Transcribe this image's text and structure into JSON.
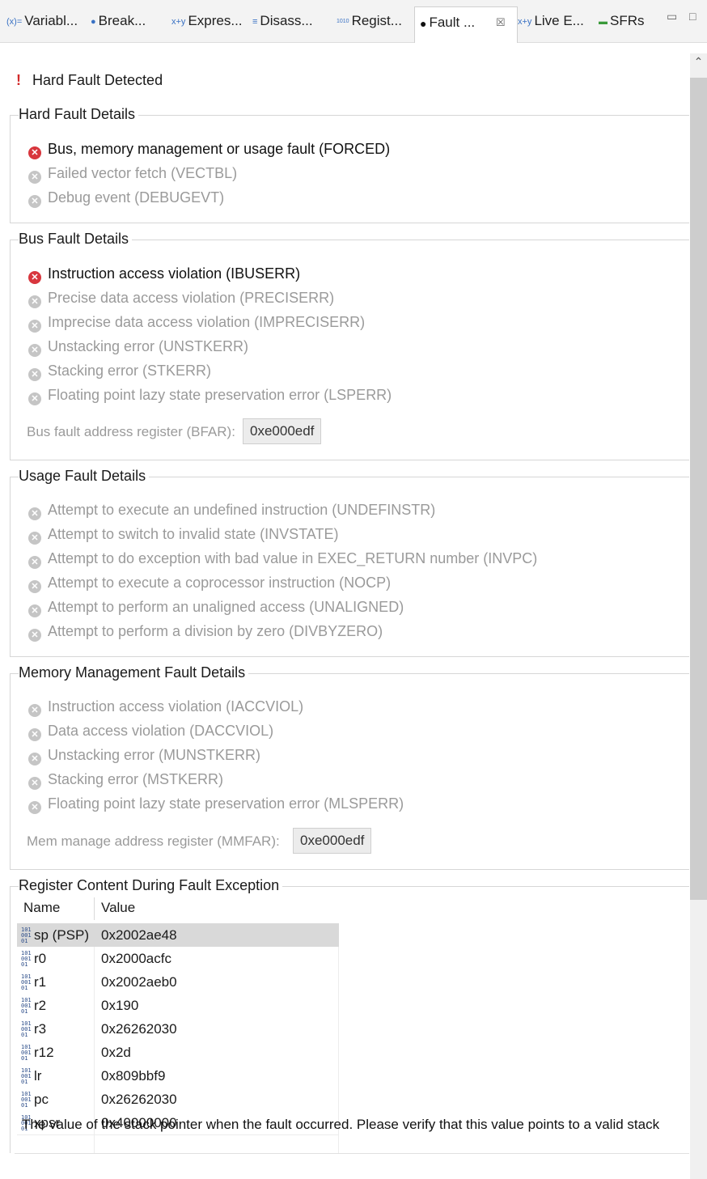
{
  "tabs": [
    {
      "label": "Variabl...",
      "icon": "variables-icon",
      "icon_text": "(x)="
    },
    {
      "label": "Break...",
      "icon": "breakpoints-icon",
      "icon_text": "●"
    },
    {
      "label": "Expres...",
      "icon": "expressions-icon",
      "icon_text": "x+y"
    },
    {
      "label": "Disass...",
      "icon": "disassembly-icon",
      "icon_text": "≡"
    },
    {
      "label": "Regist...",
      "icon": "registers-icon",
      "icon_text": "1010"
    },
    {
      "label": "Fault ...",
      "icon": "fault-analyzer-icon",
      "icon_text": "●",
      "active": true
    },
    {
      "label": "Live E...",
      "icon": "live-expressions-icon",
      "icon_text": "x+y"
    },
    {
      "label": "SFRs",
      "icon": "sfrs-icon",
      "icon_text": "▬"
    }
  ],
  "close_glyph": "☒",
  "header": {
    "alert": "Hard Fault Detected"
  },
  "hard_fault": {
    "title": "Hard Fault Details",
    "items": [
      {
        "text": "Bus, memory management or usage fault (FORCED)",
        "active": true
      },
      {
        "text": "Failed vector fetch (VECTBL)",
        "active": false
      },
      {
        "text": "Debug event (DEBUGEVT)",
        "active": false
      }
    ]
  },
  "bus_fault": {
    "title": "Bus Fault Details",
    "items": [
      {
        "text": "Instruction access violation (IBUSERR)",
        "active": true
      },
      {
        "text": "Precise data access violation (PRECISERR)",
        "active": false
      },
      {
        "text": "Imprecise data access violation (IMPRECISERR)",
        "active": false
      },
      {
        "text": "Unstacking error (UNSTKERR)",
        "active": false
      },
      {
        "text": "Stacking error (STKERR)",
        "active": false
      },
      {
        "text": "Floating point lazy state preservation error (LSPERR)",
        "active": false
      }
    ],
    "address_label": "Bus fault address register (BFAR):",
    "address_value": "0xe000edf"
  },
  "usage_fault": {
    "title": "Usage Fault Details",
    "items": [
      {
        "text": "Attempt to execute an undefined instruction (UNDEFINSTR)",
        "active": false
      },
      {
        "text": "Attempt to switch to invalid state (INVSTATE)",
        "active": false
      },
      {
        "text": "Attempt to do exception with bad value in EXEC_RETURN number (INVPC)",
        "active": false
      },
      {
        "text": "Attempt to execute a coprocessor instruction (NOCP)",
        "active": false
      },
      {
        "text": "Attempt to perform an unaligned access (UNALIGNED)",
        "active": false
      },
      {
        "text": "Attempt to perform a division by zero (DIVBYZERO)",
        "active": false
      }
    ]
  },
  "mem_fault": {
    "title": "Memory Management Fault Details",
    "items": [
      {
        "text": "Instruction access violation (IACCVIOL)",
        "active": false
      },
      {
        "text": "Data access violation (DACCVIOL)",
        "active": false
      },
      {
        "text": "Unstacking error (MUNSTKERR)",
        "active": false
      },
      {
        "text": "Stacking error (MSTKERR)",
        "active": false
      },
      {
        "text": "Floating point lazy state preservation error (MLSPERR)",
        "active": false
      }
    ],
    "address_label": "Mem manage address register (MMFAR):",
    "address_value": "0xe000edf"
  },
  "registers": {
    "title": "Register Content During Fault Exception",
    "columns": [
      "Name",
      "Value"
    ],
    "rows": [
      {
        "name": "sp (PSP)",
        "value": "0x2002ae48",
        "selected": true
      },
      {
        "name": "r0",
        "value": "0x2000acfc"
      },
      {
        "name": "r1",
        "value": "0x2002aeb0"
      },
      {
        "name": "r2",
        "value": "0x190"
      },
      {
        "name": "r3",
        "value": "0x26262030"
      },
      {
        "name": "r12",
        "value": "0x2d"
      },
      {
        "name": "lr",
        "value": "0x809bbf9"
      },
      {
        "name": "pc",
        "value": "0x26262030"
      },
      {
        "name": "xpsr",
        "value": "0x40000000"
      }
    ]
  },
  "status": "The value of the stack pointer when the fault occurred. Please verify that this value points to a valid stack"
}
